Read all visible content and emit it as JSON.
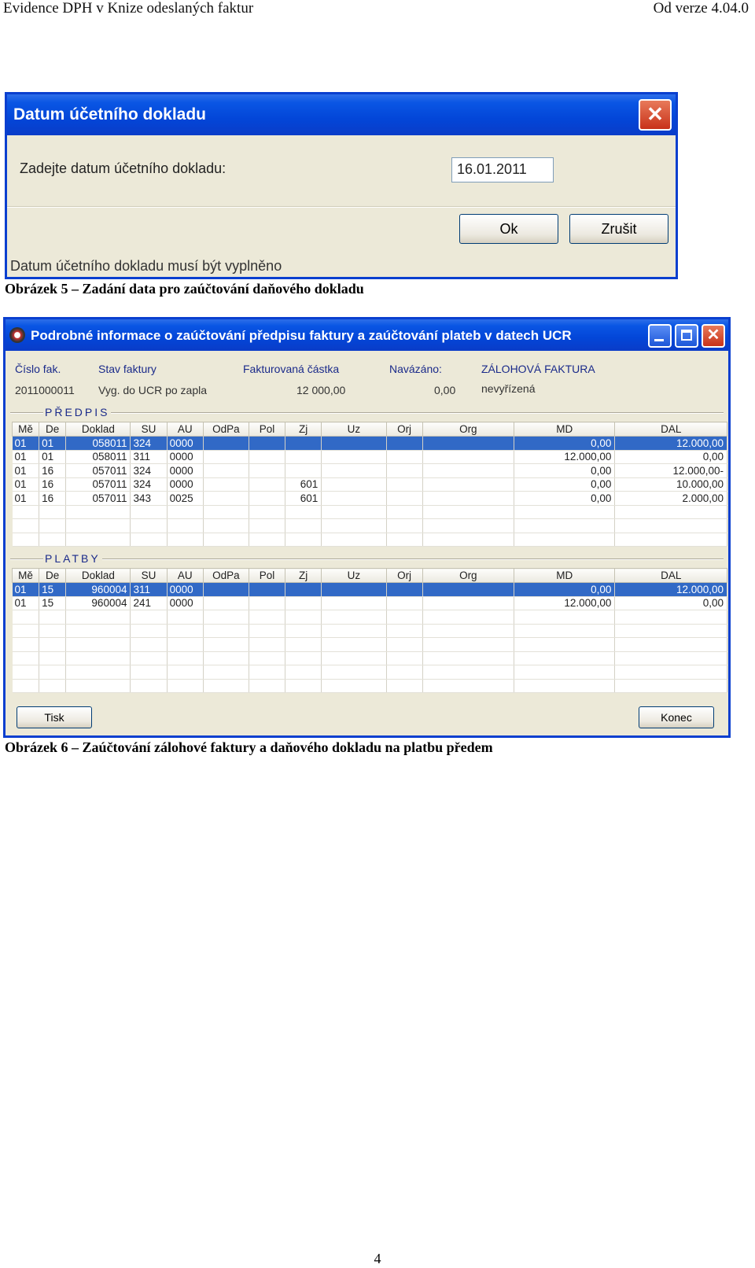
{
  "header": {
    "left": "Evidence DPH v Knize odeslaných faktur",
    "right": "Od verze 4.04.0"
  },
  "dialog1": {
    "title": "Datum účetního dokladu",
    "prompt": "Zadejte datum účetního dokladu:",
    "date_value": "16.01.2011",
    "ok_label": "Ok",
    "cancel_label": "Zrušit",
    "status": "Datum účetního dokladu musí být vyplněno"
  },
  "caption1": "Obrázek 5 – Zadání data pro zaúčtování daňového dokladu",
  "dialog2": {
    "title": "Podrobné informace o zaúčtování předpisu faktury a zaúčtování plateb v datech UCR",
    "info": {
      "labels": [
        "Číslo fak.",
        "Stav faktury",
        "Fakturovaná částka",
        "Navázáno:",
        "ZÁLOHOVÁ FAKTURA"
      ],
      "values": [
        "2011000011",
        "Vyg. do UCR po zapla",
        "12 000,00",
        "0,00",
        "nevyřízená"
      ]
    },
    "columns": [
      "Mě",
      "De",
      "Doklad",
      "SU",
      "AU",
      "OdPa",
      "Pol",
      "Zj",
      "Uz",
      "Orj",
      "Org",
      "MD",
      "DAL"
    ],
    "predpis": {
      "label": "PŘEDPIS",
      "rows": [
        [
          "01",
          "01",
          "058011",
          "324",
          "0000",
          "",
          "",
          "",
          "",
          "",
          "",
          "0,00",
          "12.000,00"
        ],
        [
          "01",
          "01",
          "058011",
          "311",
          "0000",
          "",
          "",
          "",
          "",
          "",
          "",
          "12.000,00",
          "0,00"
        ],
        [
          "01",
          "16",
          "057011",
          "324",
          "0000",
          "",
          "",
          "",
          "",
          "",
          "",
          "0,00",
          "12.000,00-"
        ],
        [
          "01",
          "16",
          "057011",
          "324",
          "0000",
          "",
          "",
          "601",
          "",
          "",
          "",
          "0,00",
          "10.000,00"
        ],
        [
          "01",
          "16",
          "057011",
          "343",
          "0025",
          "",
          "",
          "601",
          "",
          "",
          "",
          "0,00",
          "2.000,00"
        ]
      ]
    },
    "platby": {
      "label": "PLATBY",
      "rows": [
        [
          "01",
          "15",
          "960004",
          "311",
          "0000",
          "",
          "",
          "",
          "",
          "",
          "",
          "0,00",
          "12.000,00"
        ],
        [
          "01",
          "15",
          "960004",
          "241",
          "0000",
          "",
          "",
          "",
          "",
          "",
          "",
          "12.000,00",
          "0,00"
        ]
      ]
    },
    "print_label": "Tisk",
    "end_label": "Konec"
  },
  "caption2": "Obrázek 6 – Zaúčtování zálohové faktury a daňového dokladu na platbu předem",
  "page_number": "4"
}
